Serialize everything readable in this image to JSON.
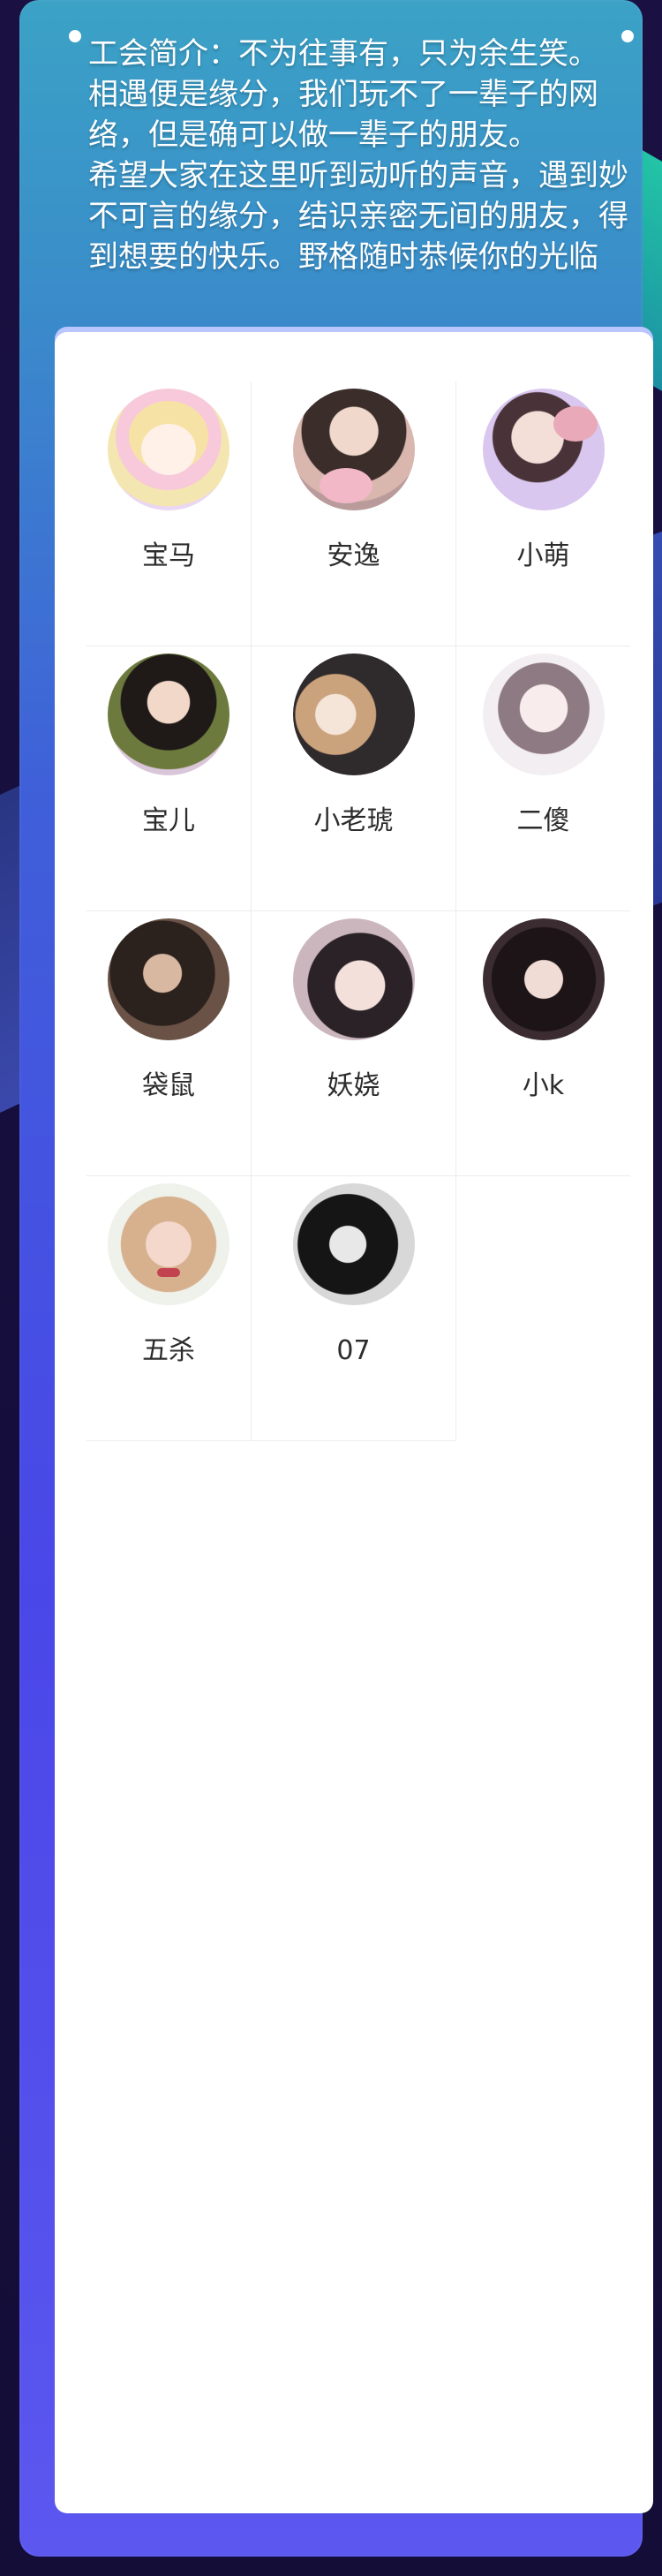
{
  "guild": {
    "intro_line1": "工会简介：不为往事有，只为余生笑。",
    "intro_line2": "相遇便是缘分，我们玩不了一辈子的网络，但是确可以做一辈子的朋友。",
    "intro_line3": "希望大家在这里听到动听的声音，遇到妙不可言的缘分，结识亲密无间的朋友，得到想要的快乐。野格随时恭候你的光临"
  },
  "members": [
    {
      "name": "宝马"
    },
    {
      "name": "安逸"
    },
    {
      "name": "小萌"
    },
    {
      "name": "宝儿"
    },
    {
      "name": "小老琥"
    },
    {
      "name": "二傻"
    },
    {
      "name": "袋鼠"
    },
    {
      "name": "妖娆"
    },
    {
      "name": "小k"
    },
    {
      "name": "五杀"
    },
    {
      "name": "07"
    }
  ]
}
